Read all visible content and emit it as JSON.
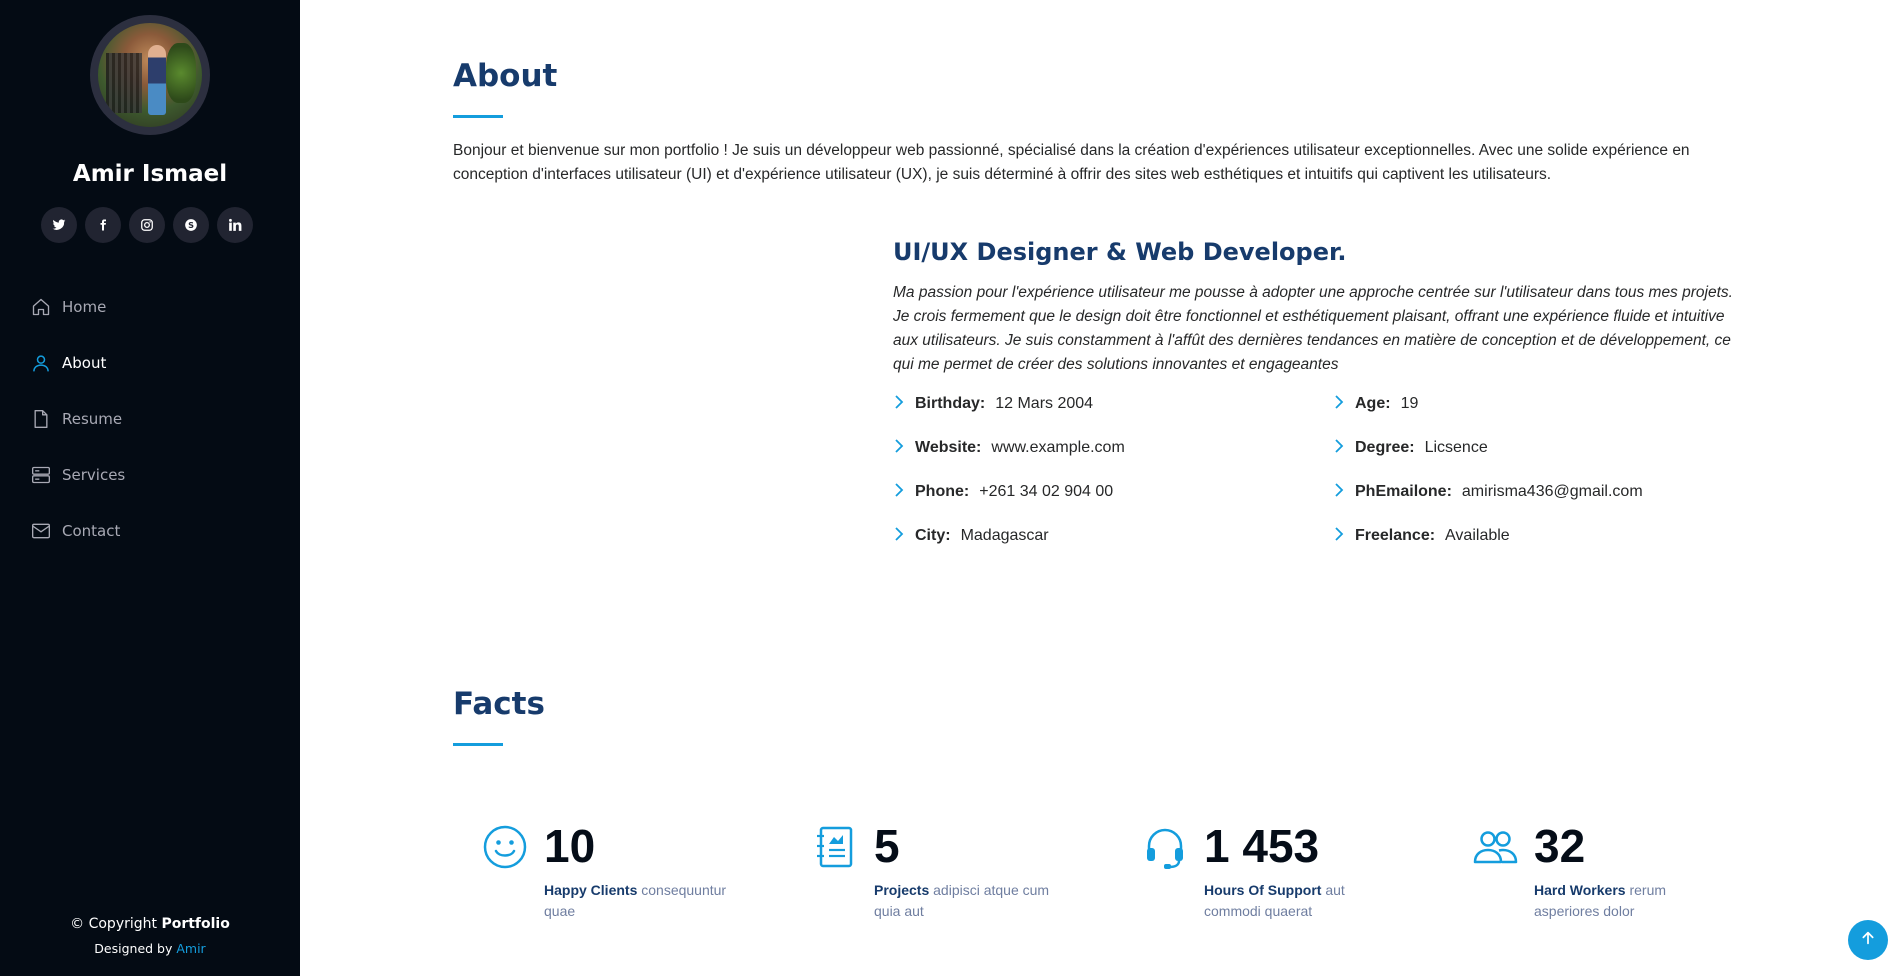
{
  "sidebar": {
    "name": "Amir Ismael",
    "socials": [
      {
        "icon": "twitter-icon",
        "glyph": "t"
      },
      {
        "icon": "facebook-icon",
        "glyph": "f"
      },
      {
        "icon": "instagram-icon",
        "glyph": "◎"
      },
      {
        "icon": "skype-icon",
        "glyph": "S"
      },
      {
        "icon": "linkedin-icon",
        "glyph": "in"
      }
    ],
    "nav": [
      {
        "label": "Home",
        "icon": "home-icon",
        "active": false
      },
      {
        "label": "About",
        "icon": "person-icon",
        "active": true
      },
      {
        "label": "Resume",
        "icon": "file-icon",
        "active": false
      },
      {
        "label": "Services",
        "icon": "server-icon",
        "active": false
      },
      {
        "label": "Contact",
        "icon": "envelope-icon",
        "active": false
      }
    ],
    "copyright_prefix": "© Copyright ",
    "copyright_brand": "Portfolio",
    "designed_prefix": "Designed by ",
    "designed_link": "Amir"
  },
  "about": {
    "title": "About",
    "intro": "Bonjour et bienvenue sur mon portfolio ! Je suis un développeur web passionné, spécialisé dans la création d'expériences utilisateur exceptionnelles. Avec une solide expérience en conception d'interfaces utilisateur (UI) et d'expérience utilisateur (UX), je suis déterminé à offrir des sites web esthétiques et intuitifs qui captivent les utilisateurs.",
    "role": "UI/UX Designer & Web Developer.",
    "role_desc": "Ma passion pour l'expérience utilisateur me pousse à adopter une approche centrée sur l'utilisateur dans tous mes projets. Je crois fermement que le design doit être fonctionnel et esthétiquement plaisant, offrant une expérience fluide et intuitive aux utilisateurs. Je suis constamment à l'affût des dernières tendances en matière de conception et de développement, ce qui me permet de créer des solutions innovantes et engageantes",
    "details": [
      {
        "label": "Birthday:",
        "value": "12 Mars 2004"
      },
      {
        "label": "Age:",
        "value": "19"
      },
      {
        "label": "Website:",
        "value": "www.example.com"
      },
      {
        "label": "Degree:",
        "value": "Licsence"
      },
      {
        "label": "Phone:",
        "value": "+261 34 02 904 00"
      },
      {
        "label": "PhEmailone:",
        "value": "amirisma436@gmail.com"
      },
      {
        "label": "City:",
        "value": "Madagascar"
      },
      {
        "label": "Freelance:",
        "value": "Available"
      }
    ]
  },
  "facts": {
    "title": "Facts",
    "items": [
      {
        "icon": "smile-icon",
        "number": "10",
        "bold": "Happy Clients",
        "text": " consequuntur quae"
      },
      {
        "icon": "journal-icon",
        "number": "5",
        "bold": "Projects",
        "text": " adipisci atque cum quia aut"
      },
      {
        "icon": "headset-icon",
        "number": "1 453",
        "bold": "Hours Of Support",
        "text": " aut commodi quaerat"
      },
      {
        "icon": "people-icon",
        "number": "32",
        "bold": "Hard Workers",
        "text": " rerum asperiores dolor"
      }
    ]
  },
  "colors": {
    "accent": "#149ddd",
    "heading": "#173b6c",
    "sidebar_bg": "#040b14"
  }
}
